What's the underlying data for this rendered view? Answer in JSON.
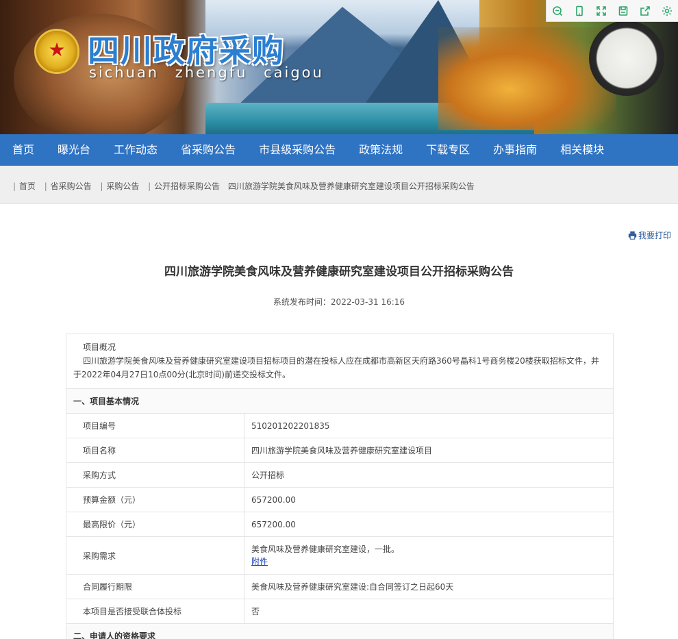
{
  "site": {
    "title": "四川政府采购",
    "subtitle": "sichuan zhengfu caigou"
  },
  "toolbar": {
    "icons": [
      "search-icon",
      "mobile-icon",
      "fullscreen-icon",
      "save-icon",
      "share-icon",
      "settings-icon"
    ],
    "color": "#2aa66a"
  },
  "nav": {
    "items": [
      "首页",
      "曝光台",
      "工作动态",
      "省采购公告",
      "市县级采购公告",
      "政策法规",
      "下载专区",
      "办事指南",
      "相关模块"
    ],
    "color": "#2f73c3"
  },
  "breadcrumb": {
    "items": [
      "首页",
      "省采购公告",
      "采购公告",
      "公开招标采购公告"
    ],
    "current": "四川旅游学院美食风味及营养健康研究室建设项目公开招标采购公告"
  },
  "print_label": "我要打印",
  "article": {
    "title": "四川旅游学院美食风味及营养健康研究室建设项目公开招标采购公告",
    "publish_time": "系统发布时间：2022-03-31 16:16",
    "overview_title": "项目概况",
    "overview_body": "四川旅游学院美食风味及营养健康研究室建设项目招标项目的潜在投标人应在成都市高新区天府路360号晶科1号商务楼20楼获取招标文件，并于2022年04月27日10点00分(北京时间)前递交投标文件。",
    "section1": "一、项目基本情况",
    "rows": [
      {
        "k": "项目编号",
        "v": "510201202201835"
      },
      {
        "k": "项目名称",
        "v": "四川旅游学院美食风味及营养健康研究室建设项目"
      },
      {
        "k": "采购方式",
        "v": "公开招标"
      },
      {
        "k": "预算金额（元）",
        "v": "657200.00"
      },
      {
        "k": "最高限价（元）",
        "v": "657200.00"
      },
      {
        "k": "采购需求",
        "v": "美食风味及营养健康研究室建设，一批。",
        "link": "附件"
      },
      {
        "k": "合同履行期限",
        "v": "美食风味及营养健康研究室建设:自合同签订之日起60天"
      },
      {
        "k": "本项目是否接受联合体投标",
        "v": "否"
      }
    ],
    "section2": "二、申请人的资格要求"
  }
}
